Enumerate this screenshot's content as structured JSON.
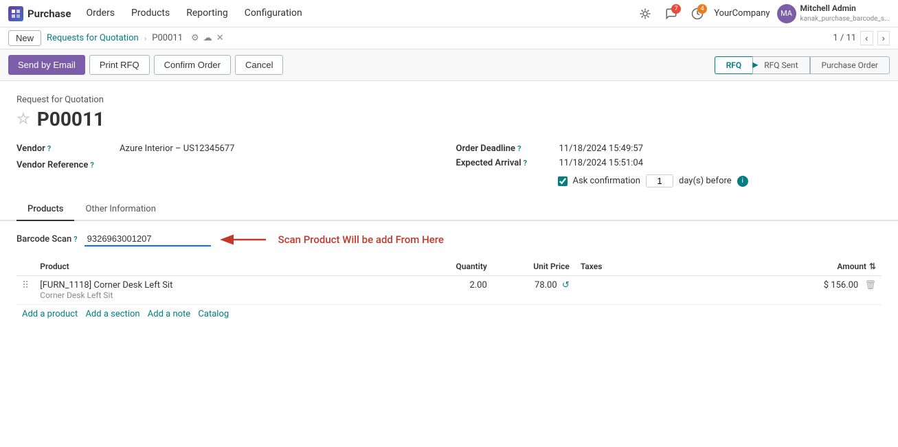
{
  "nav": {
    "logo_text": "P",
    "app_name": "Purchase",
    "menu_items": [
      "Orders",
      "Products",
      "Reporting",
      "Configuration"
    ],
    "bug_icon": "🐛",
    "messages_count": "7",
    "activities_count": "4",
    "company": "YourCompany",
    "user_name": "Mitchell Admin",
    "user_sub": "kanak_purchase_barcode_s...",
    "avatar_initials": "MA"
  },
  "breadcrumb": {
    "new_label": "New",
    "link_label": "Requests for Quotation",
    "current": "P00011",
    "record_position": "1 / 11"
  },
  "actions": {
    "send_email": "Send by Email",
    "print_rfq": "Print RFQ",
    "confirm_order": "Confirm Order",
    "cancel": "Cancel",
    "status_steps": [
      "RFQ",
      "RFQ Sent",
      "Purchase Order"
    ],
    "active_step": 0
  },
  "form": {
    "form_label": "Request for Quotation",
    "order_number": "P00011",
    "vendor_label": "Vendor",
    "vendor_help": "?",
    "vendor_value": "Azure Interior – US12345677",
    "vendor_ref_label": "Vendor Reference",
    "vendor_ref_help": "?",
    "order_deadline_label": "Order Deadline",
    "order_deadline_help": "?",
    "order_deadline_value": "11/18/2024 15:49:57",
    "expected_arrival_label": "Expected Arrival",
    "expected_arrival_help": "?",
    "expected_arrival_value": "11/18/2024 15:51:04",
    "ask_confirmation_label": "Ask confirmation",
    "ask_confirmation_days": "1",
    "ask_confirmation_unit": "day(s) before"
  },
  "tabs": {
    "items": [
      "Products",
      "Other Information"
    ],
    "active": 0
  },
  "barcode": {
    "label": "Barcode Scan",
    "help": "?",
    "value": "9326963001207",
    "annotation": "Scan Product Will be add From Here"
  },
  "table": {
    "columns": [
      "",
      "Product",
      "Quantity",
      "Unit Price",
      "Taxes",
      "Amount"
    ],
    "rows": [
      {
        "handle": "⠿",
        "product_code": "[FURN_1118] Corner Desk Left Sit",
        "product_desc": "Corner Desk Left Sit",
        "quantity": "2.00",
        "unit_price": "78.00",
        "taxes": "",
        "amount": "$ 156.00"
      }
    ],
    "actions": [
      "Add a product",
      "Add a section",
      "Add a note",
      "Catalog"
    ]
  }
}
